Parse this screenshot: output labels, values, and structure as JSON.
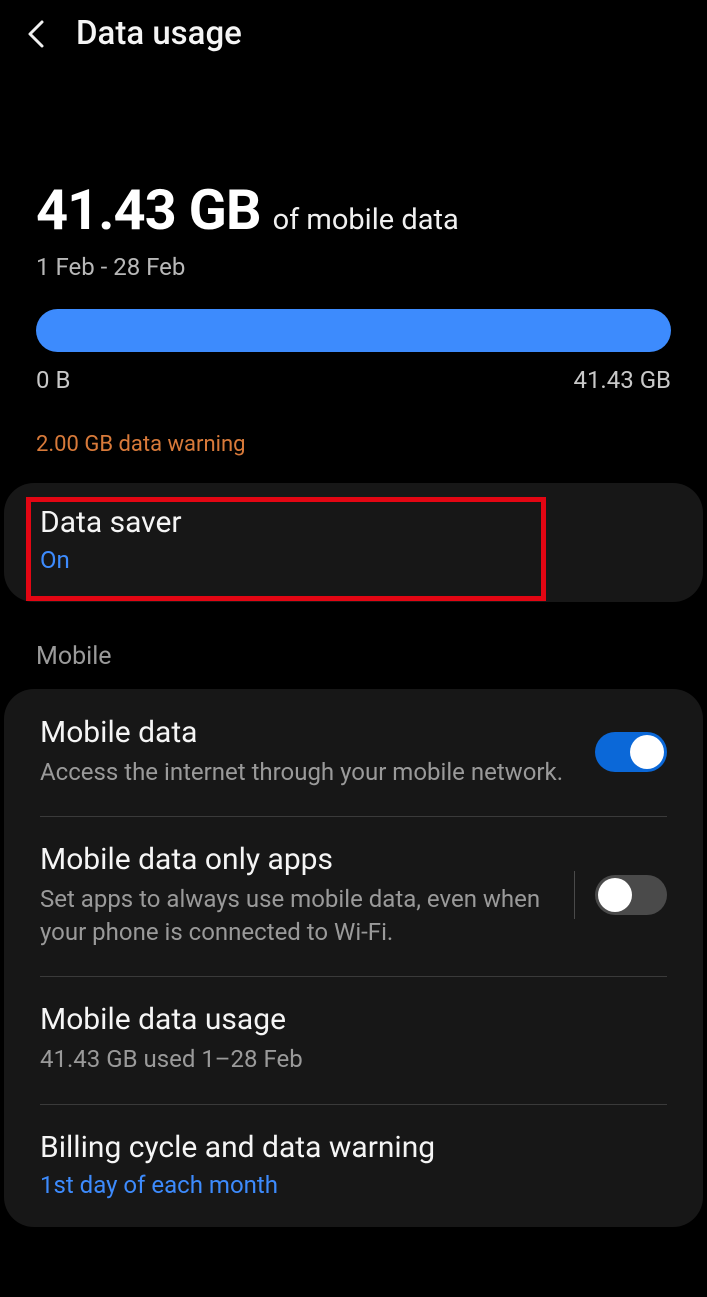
{
  "header": {
    "title": "Data usage"
  },
  "summary": {
    "amount": "41.43 GB",
    "suffix": "of mobile data",
    "period": "1 Feb - 28 Feb",
    "min_label": "0 B",
    "max_label": "41.43 GB",
    "warning": "2.00 GB data warning"
  },
  "data_saver": {
    "title": "Data saver",
    "status": "On"
  },
  "mobile_section": {
    "label": "Mobile",
    "rows": [
      {
        "title": "Mobile data",
        "subtitle": "Access the internet through your mobile network.",
        "toggle": "on"
      },
      {
        "title": "Mobile data only apps",
        "subtitle": "Set apps to always use mobile data, even when your phone is connected to Wi-Fi.",
        "toggle": "off"
      },
      {
        "title": "Mobile data usage",
        "subtitle": "41.43 GB used 1–28 Feb"
      },
      {
        "title": "Billing cycle and data warning",
        "subtitle": "1st day of each month"
      }
    ]
  }
}
